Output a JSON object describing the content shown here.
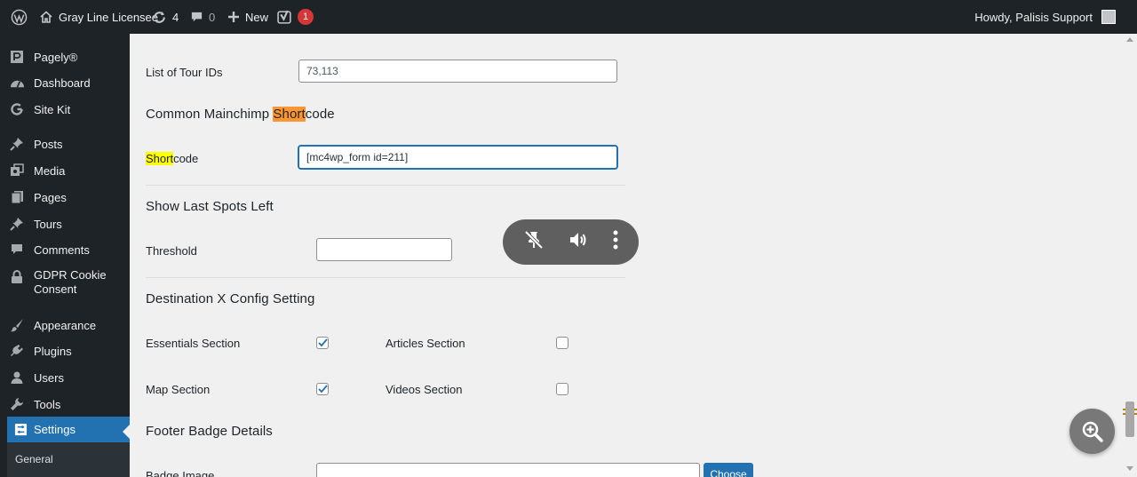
{
  "adminbar": {
    "site_name": "Gray Line Licensee",
    "updates_count": "4",
    "comments_count": "0",
    "new_label": "New",
    "seo_badge": "1",
    "howdy": "Howdy, Palisis Support"
  },
  "sidebar": {
    "items": [
      {
        "label": "Pagely®",
        "icon": "pagely-icon"
      },
      {
        "label": "Dashboard",
        "icon": "dashboard-icon"
      },
      {
        "label": "Site Kit",
        "icon": "google-icon"
      },
      {
        "label": "Posts",
        "icon": "pin-icon"
      },
      {
        "label": "Media",
        "icon": "media-icon"
      },
      {
        "label": "Pages",
        "icon": "pages-icon"
      },
      {
        "label": "Tours",
        "icon": "pin-icon"
      },
      {
        "label": "Comments",
        "icon": "comment-icon"
      },
      {
        "label": "GDPR Cookie Consent",
        "label_line1": "GDPR Cookie",
        "label_line2": "Consent",
        "icon": "lock-icon"
      },
      {
        "label": "Appearance",
        "icon": "brush-icon"
      },
      {
        "label": "Plugins",
        "icon": "plugin-icon"
      },
      {
        "label": "Users",
        "icon": "users-icon"
      },
      {
        "label": "Tools",
        "icon": "wrench-icon"
      },
      {
        "label": "Settings",
        "icon": "settings-icon",
        "active": true
      }
    ],
    "submenu_item": "General"
  },
  "form": {
    "tour_ids_label": "List of Tour IDs",
    "tour_ids_value": "73,113",
    "mailchimp_heading_pre": "Common Mainchimp ",
    "mailchimp_heading_hl": "Short",
    "mailchimp_heading_post": "code",
    "shortcode_label_hl": "Short",
    "shortcode_label_post": "code",
    "shortcode_value": "[mc4wp_form id=211]",
    "spots_heading": "Show Last Spots Left",
    "threshold_label": "Threshold",
    "threshold_value": "",
    "destx_heading": "Destination X Config Setting",
    "essentials_label": "Essentials Section",
    "essentials_checked": true,
    "articles_label": "Articles Section",
    "articles_checked": false,
    "map_label": "Map Section",
    "map_checked": true,
    "videos_label": "Videos Section",
    "videos_checked": false,
    "footer_heading": "Footer Badge Details",
    "badge_image_label": "Badge Image",
    "choose_button": "Choose"
  },
  "colors": {
    "adminbar_bg": "#1d2327",
    "accent": "#2271b1",
    "highlight_yellow": "#ffff00",
    "highlight_orange": "#ff9632",
    "badge_red": "#d63638"
  }
}
